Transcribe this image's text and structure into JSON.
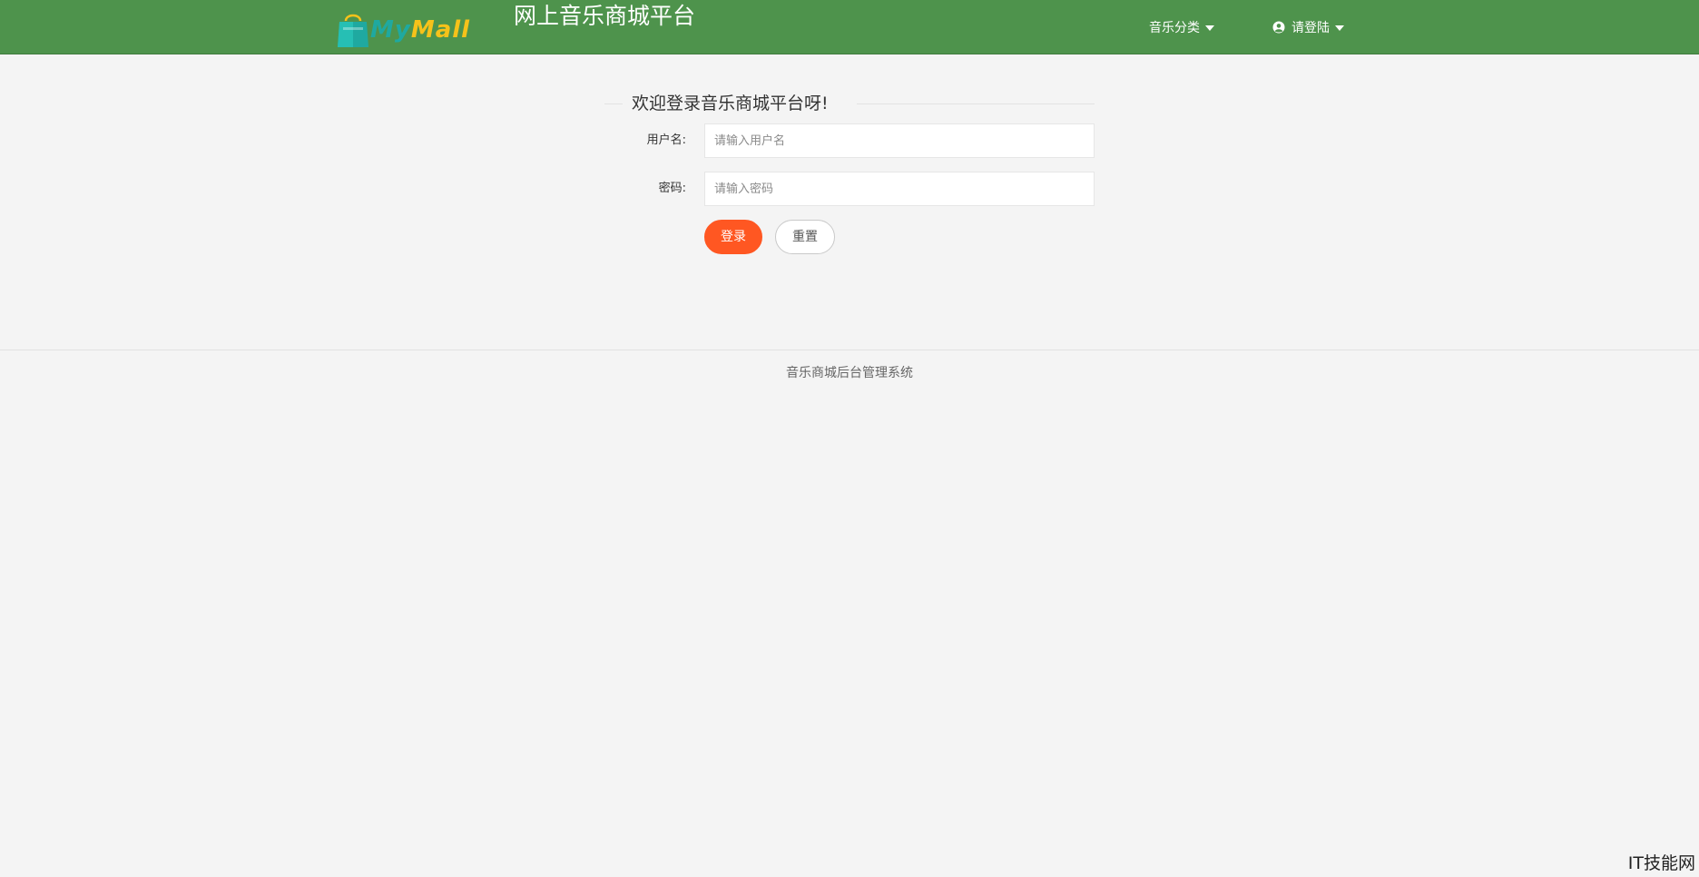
{
  "header": {
    "logo_text_part1": "My",
    "logo_text_part2": "Mall",
    "site_title": "网上音乐商城平台",
    "nav_category_label": "音乐分类",
    "nav_user_label": "请登陆",
    "background_color": "#4e934c"
  },
  "login": {
    "legend_title": "欢迎登录音乐商城平台呀!",
    "username_label": "用户名:",
    "username_placeholder": "请输入用户名",
    "username_value": "",
    "password_label": "密码:",
    "password_placeholder": "请输入密码",
    "password_value": "",
    "login_button_label": "登录",
    "reset_button_label": "重置",
    "login_button_color": "#ff5722"
  },
  "footer": {
    "text": "音乐商城后台管理系统"
  },
  "watermark": {
    "text": "IT技能网"
  },
  "icons": {
    "logo": "shopping-bag-icon",
    "user": "user-circle-icon",
    "dropdown": "caret-down-icon"
  }
}
